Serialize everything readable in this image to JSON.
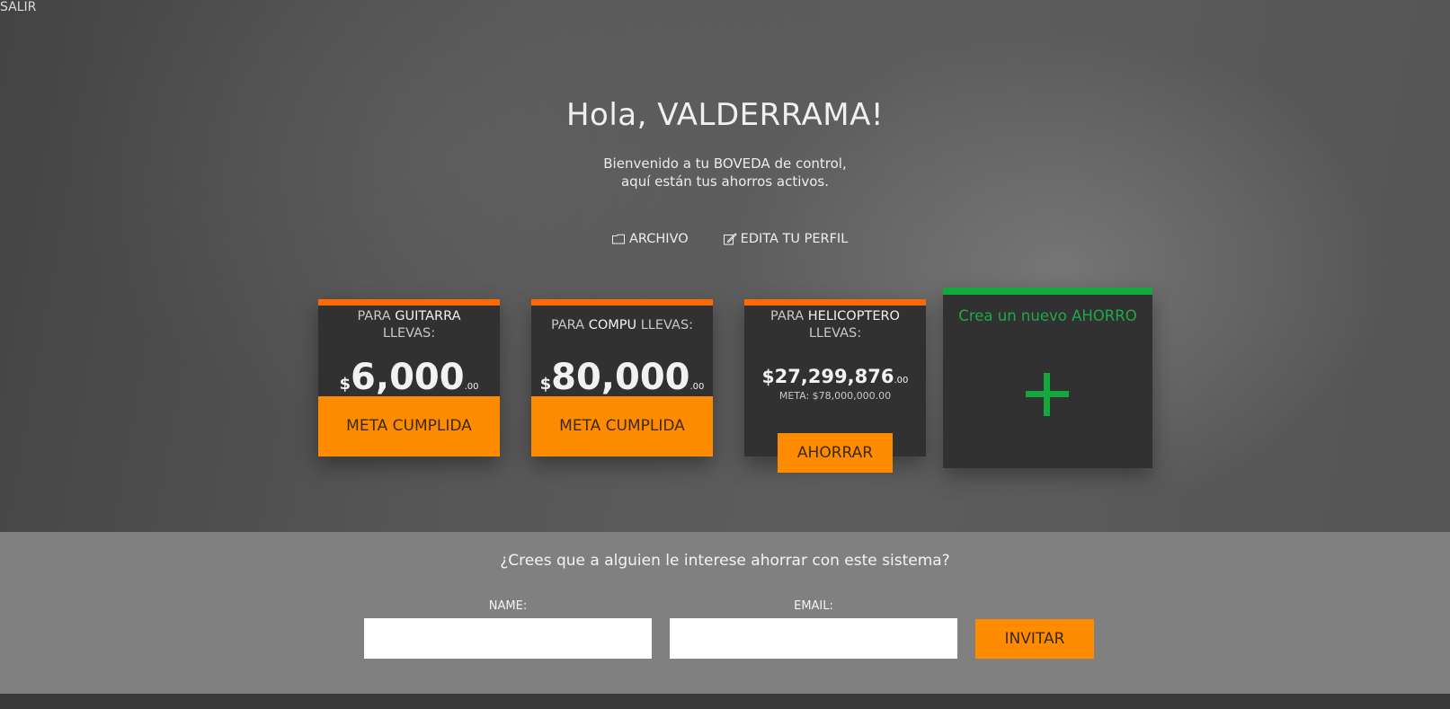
{
  "header": {
    "logout_label": "SALIR"
  },
  "hero": {
    "greeting": "Hola, VALDERRAMA!",
    "subtitle_line1": "Bienvenido a tu BOVEDA de control,",
    "subtitle_line2": "aquí están tus ahorros activos."
  },
  "nav": {
    "archive_label": "ARCHIVO",
    "archive_icon": "folder-icon",
    "profile_label": "EDITA TU PERFIL",
    "profile_icon": "edit-icon"
  },
  "savings": [
    {
      "prefix": "PARA ",
      "name": "GUITARRA",
      "suffix": "LLEVAS:",
      "currency": "$",
      "amount": "6,000",
      "cents": ".00",
      "status": "META CUMPLIDA"
    },
    {
      "prefix": "PARA ",
      "name": "COMPU",
      "suffix": " LLEVAS:",
      "currency": "$",
      "amount": "80,000",
      "cents": ".00",
      "status": "META CUMPLIDA"
    },
    {
      "prefix": "PARA ",
      "name": "HELICOPTERO",
      "suffix": "LLEVAS:",
      "currency": "$",
      "amount": "27,299,876",
      "cents": ".00",
      "goal": "META: $78,000,000.00",
      "action": "AHORRAR"
    }
  ],
  "new_saving": {
    "title": "Crea un nuevo AHORRO",
    "icon": "plus-icon"
  },
  "invite": {
    "question": "¿Crees que a alguien le interese ahorrar con este sistema?",
    "name_label": "NAME:",
    "name_value": "",
    "email_label": "EMAIL:",
    "email_value": "",
    "submit_label": "INVITAR"
  },
  "colors": {
    "accent_orange": "#ff8c00",
    "topbar_orange": "#ff6a00",
    "accent_green": "#14a83c",
    "card_bg": "#313131",
    "invite_bg": "#808080"
  }
}
